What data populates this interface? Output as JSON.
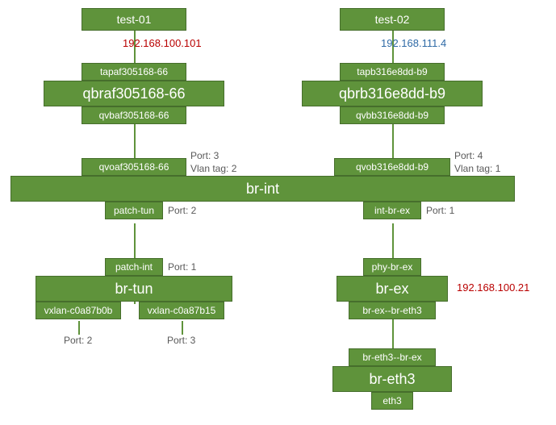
{
  "diagram": {
    "test01": {
      "label": "test-01",
      "ip": "192.168.100.101"
    },
    "test02": {
      "label": "test-02",
      "ip": "192.168.111.4"
    },
    "left": {
      "tap": "tapaf305168-66",
      "qbr": "qbraf305168-66",
      "qvb": "qvbaf305168-66",
      "qvo": "qvoaf305168-66",
      "qvo_port": "Port: 3",
      "qvo_vlan": "Vlan tag: 2"
    },
    "right": {
      "tap": "tapb316e8dd-b9",
      "qbr": "qbrb316e8dd-b9",
      "qvb": "qvbb316e8dd-b9",
      "qvo": "qvob316e8dd-b9",
      "qvo_port": "Port: 4",
      "qvo_vlan": "Vlan tag: 1"
    },
    "br_int": "br-int",
    "patch_tun": {
      "label": "patch-tun",
      "port": "Port: 2"
    },
    "int_br_ex": {
      "label": "int-br-ex",
      "port": "Port: 1"
    },
    "patch_int": {
      "label": "patch-int",
      "port": "Port: 1"
    },
    "phy_br_ex": {
      "label": "phy-br-ex"
    },
    "br_tun": "br-tun",
    "br_ex": {
      "label": "br-ex",
      "ip": "192.168.100.21"
    },
    "vxlan1": {
      "label": "vxlan-c0a87b0b",
      "port": "Port: 2"
    },
    "vxlan2": {
      "label": "vxlan-c0a87b15",
      "port": "Port: 3"
    },
    "br_ex_link": "br-ex--br-eth3",
    "br_eth3_link": "br-eth3--br-ex",
    "br_eth3": "br-eth3",
    "eth3": "eth3"
  }
}
